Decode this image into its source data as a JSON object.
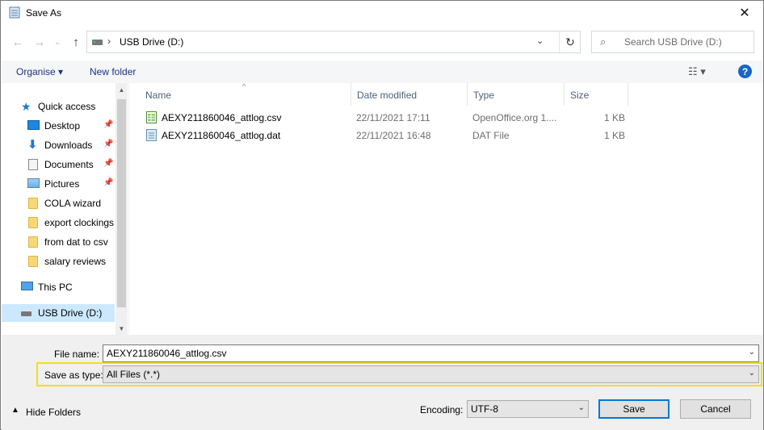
{
  "window": {
    "title": "Save As",
    "close_glyph": "✕"
  },
  "address": {
    "path": "USB Drive (D:)",
    "separator": "›"
  },
  "search": {
    "placeholder": "Search USB Drive (D:)"
  },
  "toolbar": {
    "organise": "Organise ▾",
    "new_folder": "New folder",
    "help": "?"
  },
  "sidebar": {
    "items": [
      {
        "label": "Quick access",
        "icon": "star-icon"
      },
      {
        "label": "Desktop",
        "icon": "desktop-icon",
        "pinned": true
      },
      {
        "label": "Downloads",
        "icon": "download-icon",
        "pinned": true
      },
      {
        "label": "Documents",
        "icon": "documents-icon",
        "pinned": true
      },
      {
        "label": "Pictures",
        "icon": "pictures-icon",
        "pinned": true
      },
      {
        "label": "COLA wizard",
        "icon": "folder-icon"
      },
      {
        "label": "export clockings",
        "icon": "folder-icon"
      },
      {
        "label": "from dat to csv",
        "icon": "folder-icon"
      },
      {
        "label": "salary reviews",
        "icon": "folder-icon"
      },
      {
        "label": "This PC",
        "icon": "pc-icon"
      },
      {
        "label": "USB Drive (D:)",
        "icon": "drive-icon",
        "selected": true
      }
    ]
  },
  "columns": {
    "name": "Name",
    "date": "Date modified",
    "type": "Type",
    "size": "Size"
  },
  "files": [
    {
      "name": "AEXY211860046_attlog.csv",
      "date": "22/11/2021 17:11",
      "type": "OpenOffice.org 1....",
      "size": "1 KB",
      "icon": "spreadsheet-file-icon"
    },
    {
      "name": "AEXY211860046_attlog.dat",
      "date": "22/11/2021 16:48",
      "type": "DAT File",
      "size": "1 KB",
      "icon": "dat-file-icon"
    }
  ],
  "form": {
    "file_name_label": "File name:",
    "file_name_value": "AEXY211860046_attlog.csv",
    "save_type_label": "Save as type:",
    "save_type_value": "All Files  (*.*)",
    "encoding_label": "Encoding:",
    "encoding_value": "UTF-8"
  },
  "buttons": {
    "hide_folders": "Hide Folders",
    "save": "Save",
    "cancel": "Cancel"
  },
  "colors": {
    "highlight": "#f0e01a",
    "accent": "#0078d7",
    "selected": "#cce8ff"
  }
}
